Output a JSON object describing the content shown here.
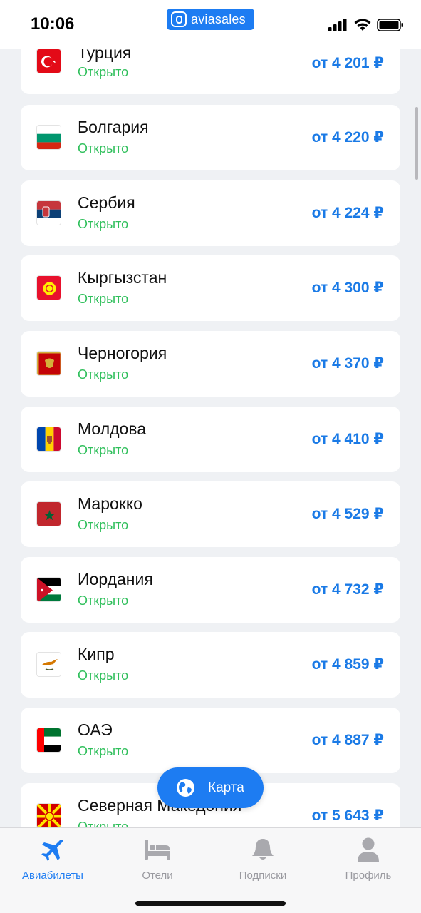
{
  "status_bar": {
    "time": "10:06",
    "brand": "aviasales"
  },
  "countries": [
    {
      "name": "Турция",
      "status": "Открыто",
      "price": "от 4 201 ₽",
      "flag": "turkey"
    },
    {
      "name": "Болгария",
      "status": "Открыто",
      "price": "от 4 220 ₽",
      "flag": "bulgaria"
    },
    {
      "name": "Сербия",
      "status": "Открыто",
      "price": "от 4 224 ₽",
      "flag": "serbia"
    },
    {
      "name": "Кыргызстан",
      "status": "Открыто",
      "price": "от 4 300 ₽",
      "flag": "kyrgyzstan"
    },
    {
      "name": "Черногория",
      "status": "Открыто",
      "price": "от 4 370 ₽",
      "flag": "montenegro"
    },
    {
      "name": "Молдова",
      "status": "Открыто",
      "price": "от 4 410 ₽",
      "flag": "moldova"
    },
    {
      "name": "Марокко",
      "status": "Открыто",
      "price": "от 4 529 ₽",
      "flag": "morocco"
    },
    {
      "name": "Иордания",
      "status": "Открыто",
      "price": "от 4 732 ₽",
      "flag": "jordan"
    },
    {
      "name": "Кипр",
      "status": "Открыто",
      "price": "от 4 859 ₽",
      "flag": "cyprus"
    },
    {
      "name": "ОАЭ",
      "status": "Открыто",
      "price": "от 4 887 ₽",
      "flag": "uae"
    },
    {
      "name": "Северная Македония",
      "status": "Открыто",
      "price": "от 5 643 ₽",
      "flag": "north-macedonia"
    }
  ],
  "map_button": {
    "label": "Карта",
    "icon": "globe-icon"
  },
  "tabbar": {
    "tabs": [
      {
        "label": "Авиабилеты",
        "icon": "plane-icon",
        "active": true
      },
      {
        "label": "Отели",
        "icon": "bed-icon",
        "active": false
      },
      {
        "label": "Подписки",
        "icon": "bell-icon",
        "active": false
      },
      {
        "label": "Профиль",
        "icon": "person-icon",
        "active": false
      }
    ]
  },
  "colors": {
    "accent": "#1d7cf2",
    "open_status": "#2fbf5b",
    "price": "#1a7ae6"
  }
}
